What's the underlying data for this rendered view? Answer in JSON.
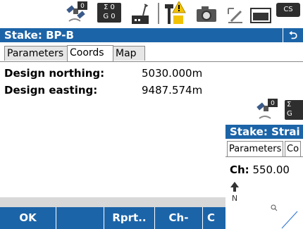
{
  "status_bar": {
    "icons": [
      "satellite-icon",
      "sigma-g-counter-icon",
      "radio-link-icon",
      "antenna-warning-icon",
      "camera-icon",
      "pen-icon",
      "battery-icon",
      "controller-cs-icon"
    ],
    "sigma_top": "Σ 0",
    "sigma_bottom": "G 0",
    "sat_badge": "0",
    "cs_label": "CS"
  },
  "window": {
    "title": "Stake: BP-B",
    "back_symbol": "⮌",
    "tabs": [
      "Parameters",
      "Coords",
      "Map"
    ],
    "active_tab": "Coords"
  },
  "fields": [
    {
      "label": "Design northing:",
      "value": "5030.000m"
    },
    {
      "label": "Design easting:",
      "value": "9487.574m"
    }
  ],
  "softkeys": [
    "OK",
    "",
    "Rprt..",
    "Ch-",
    "C"
  ],
  "second_window": {
    "title": "Stake: Strai",
    "tabs": [
      "Parameters",
      "Co"
    ],
    "ch_label": "Ch:",
    "ch_value": "550.00",
    "north_label": "N",
    "sigma_top": "Σ",
    "sigma_bottom": "G",
    "sat_badge": "0"
  },
  "colors": {
    "title_bar": "#1c64a8",
    "softkey_bar": "#1c64a8",
    "warning": "#f2c200",
    "cs_badge": "#2e2e2e"
  }
}
